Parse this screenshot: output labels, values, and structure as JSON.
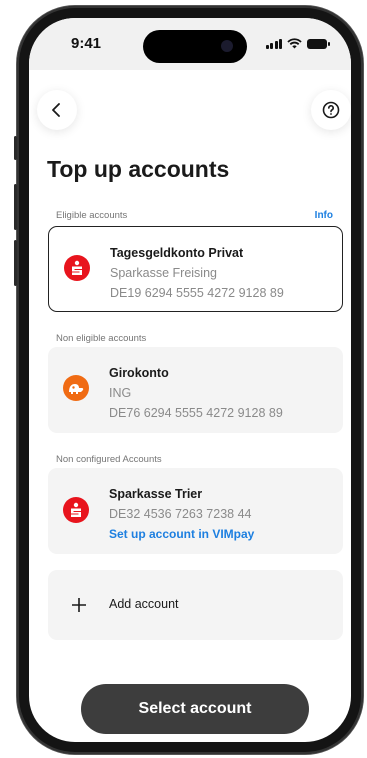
{
  "status_bar": {
    "time": "9:41"
  },
  "nav": {
    "back_icon": "chevron-left-icon",
    "help_icon": "help-circle-icon"
  },
  "page": {
    "title": "Top up accounts"
  },
  "sections": {
    "eligible": {
      "label": "Eligible accounts",
      "info_link": "Info"
    },
    "non_eligible": {
      "label": "Non eligible accounts"
    },
    "non_configured": {
      "label": "Non configured Accounts"
    }
  },
  "accounts": {
    "eligible": {
      "name": "Tagesgeldkonto Privat",
      "bank": "Sparkasse Freising",
      "iban": "DE19 6294 5555 4272 9128 89",
      "logo": "sparkasse-logo-icon",
      "selected": true
    },
    "non_eligible": {
      "name": "Girokonto",
      "bank": "ING",
      "iban": "DE76 6294 5555 4272 9128 89",
      "logo": "ing-lion-logo-icon"
    },
    "non_configured": {
      "name": "Sparkasse Trier",
      "iban": "DE32 4536 7263 7238 44",
      "setup_link": "Set up account in VIMpay",
      "logo": "sparkasse-logo-icon"
    }
  },
  "add_account": {
    "label": "Add account",
    "icon": "plus-icon"
  },
  "cta": {
    "label": "Select account"
  },
  "colors": {
    "sparkasse_red": "#e8141d",
    "ing_orange": "#f06b13",
    "link_blue": "#1d7fe0",
    "cta_bg": "#3d3d3d"
  }
}
